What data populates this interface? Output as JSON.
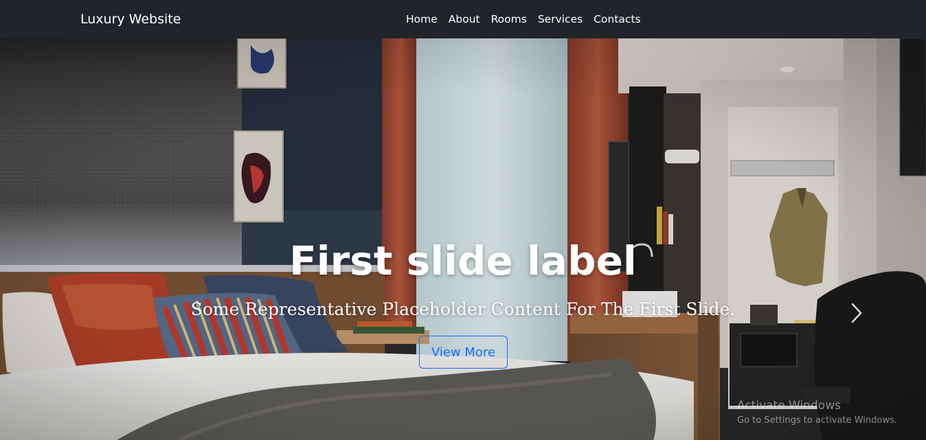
{
  "navbar": {
    "brand": "Luxury Website",
    "links": [
      "Home",
      "About",
      "Rooms",
      "Services",
      "Contacts"
    ]
  },
  "carousel": {
    "slide_title": "First slide label",
    "slide_text": "Some Representative Placeholder Content For The First Slide.",
    "button_label": "View More",
    "next_icon": "chevron-right-icon",
    "accent_color": "#0d6efd"
  },
  "watermark": {
    "title": "Activate Windows",
    "subtitle": "Go to Settings to activate Windows."
  }
}
